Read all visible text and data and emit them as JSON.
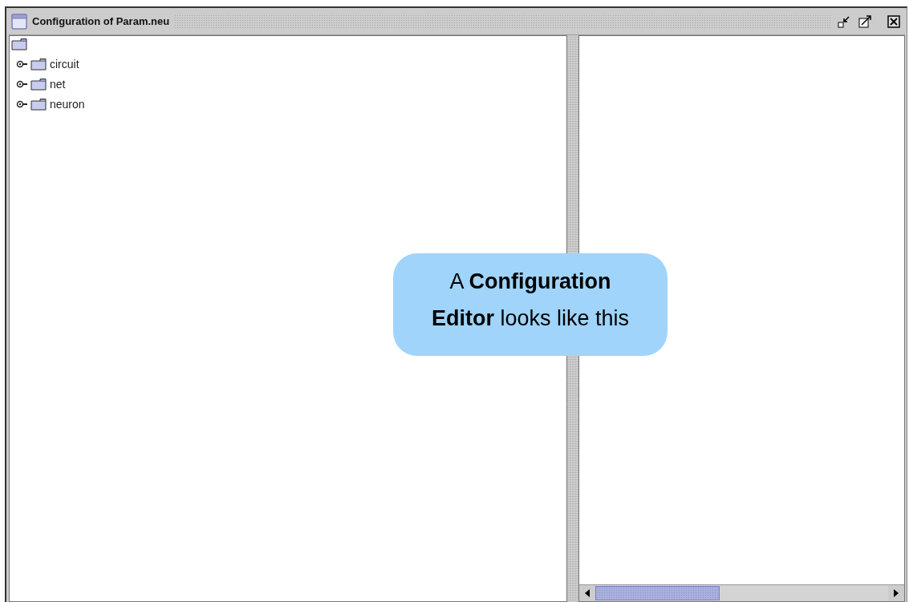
{
  "window": {
    "title": "Configuration of Param.neu"
  },
  "tree": {
    "items": [
      {
        "label": "circuit",
        "expanded": false
      },
      {
        "label": "net",
        "expanded": false
      },
      {
        "label": "neuron",
        "expanded": false
      }
    ]
  },
  "callout": {
    "text": "A **Configuration Editor** looks like this"
  }
}
